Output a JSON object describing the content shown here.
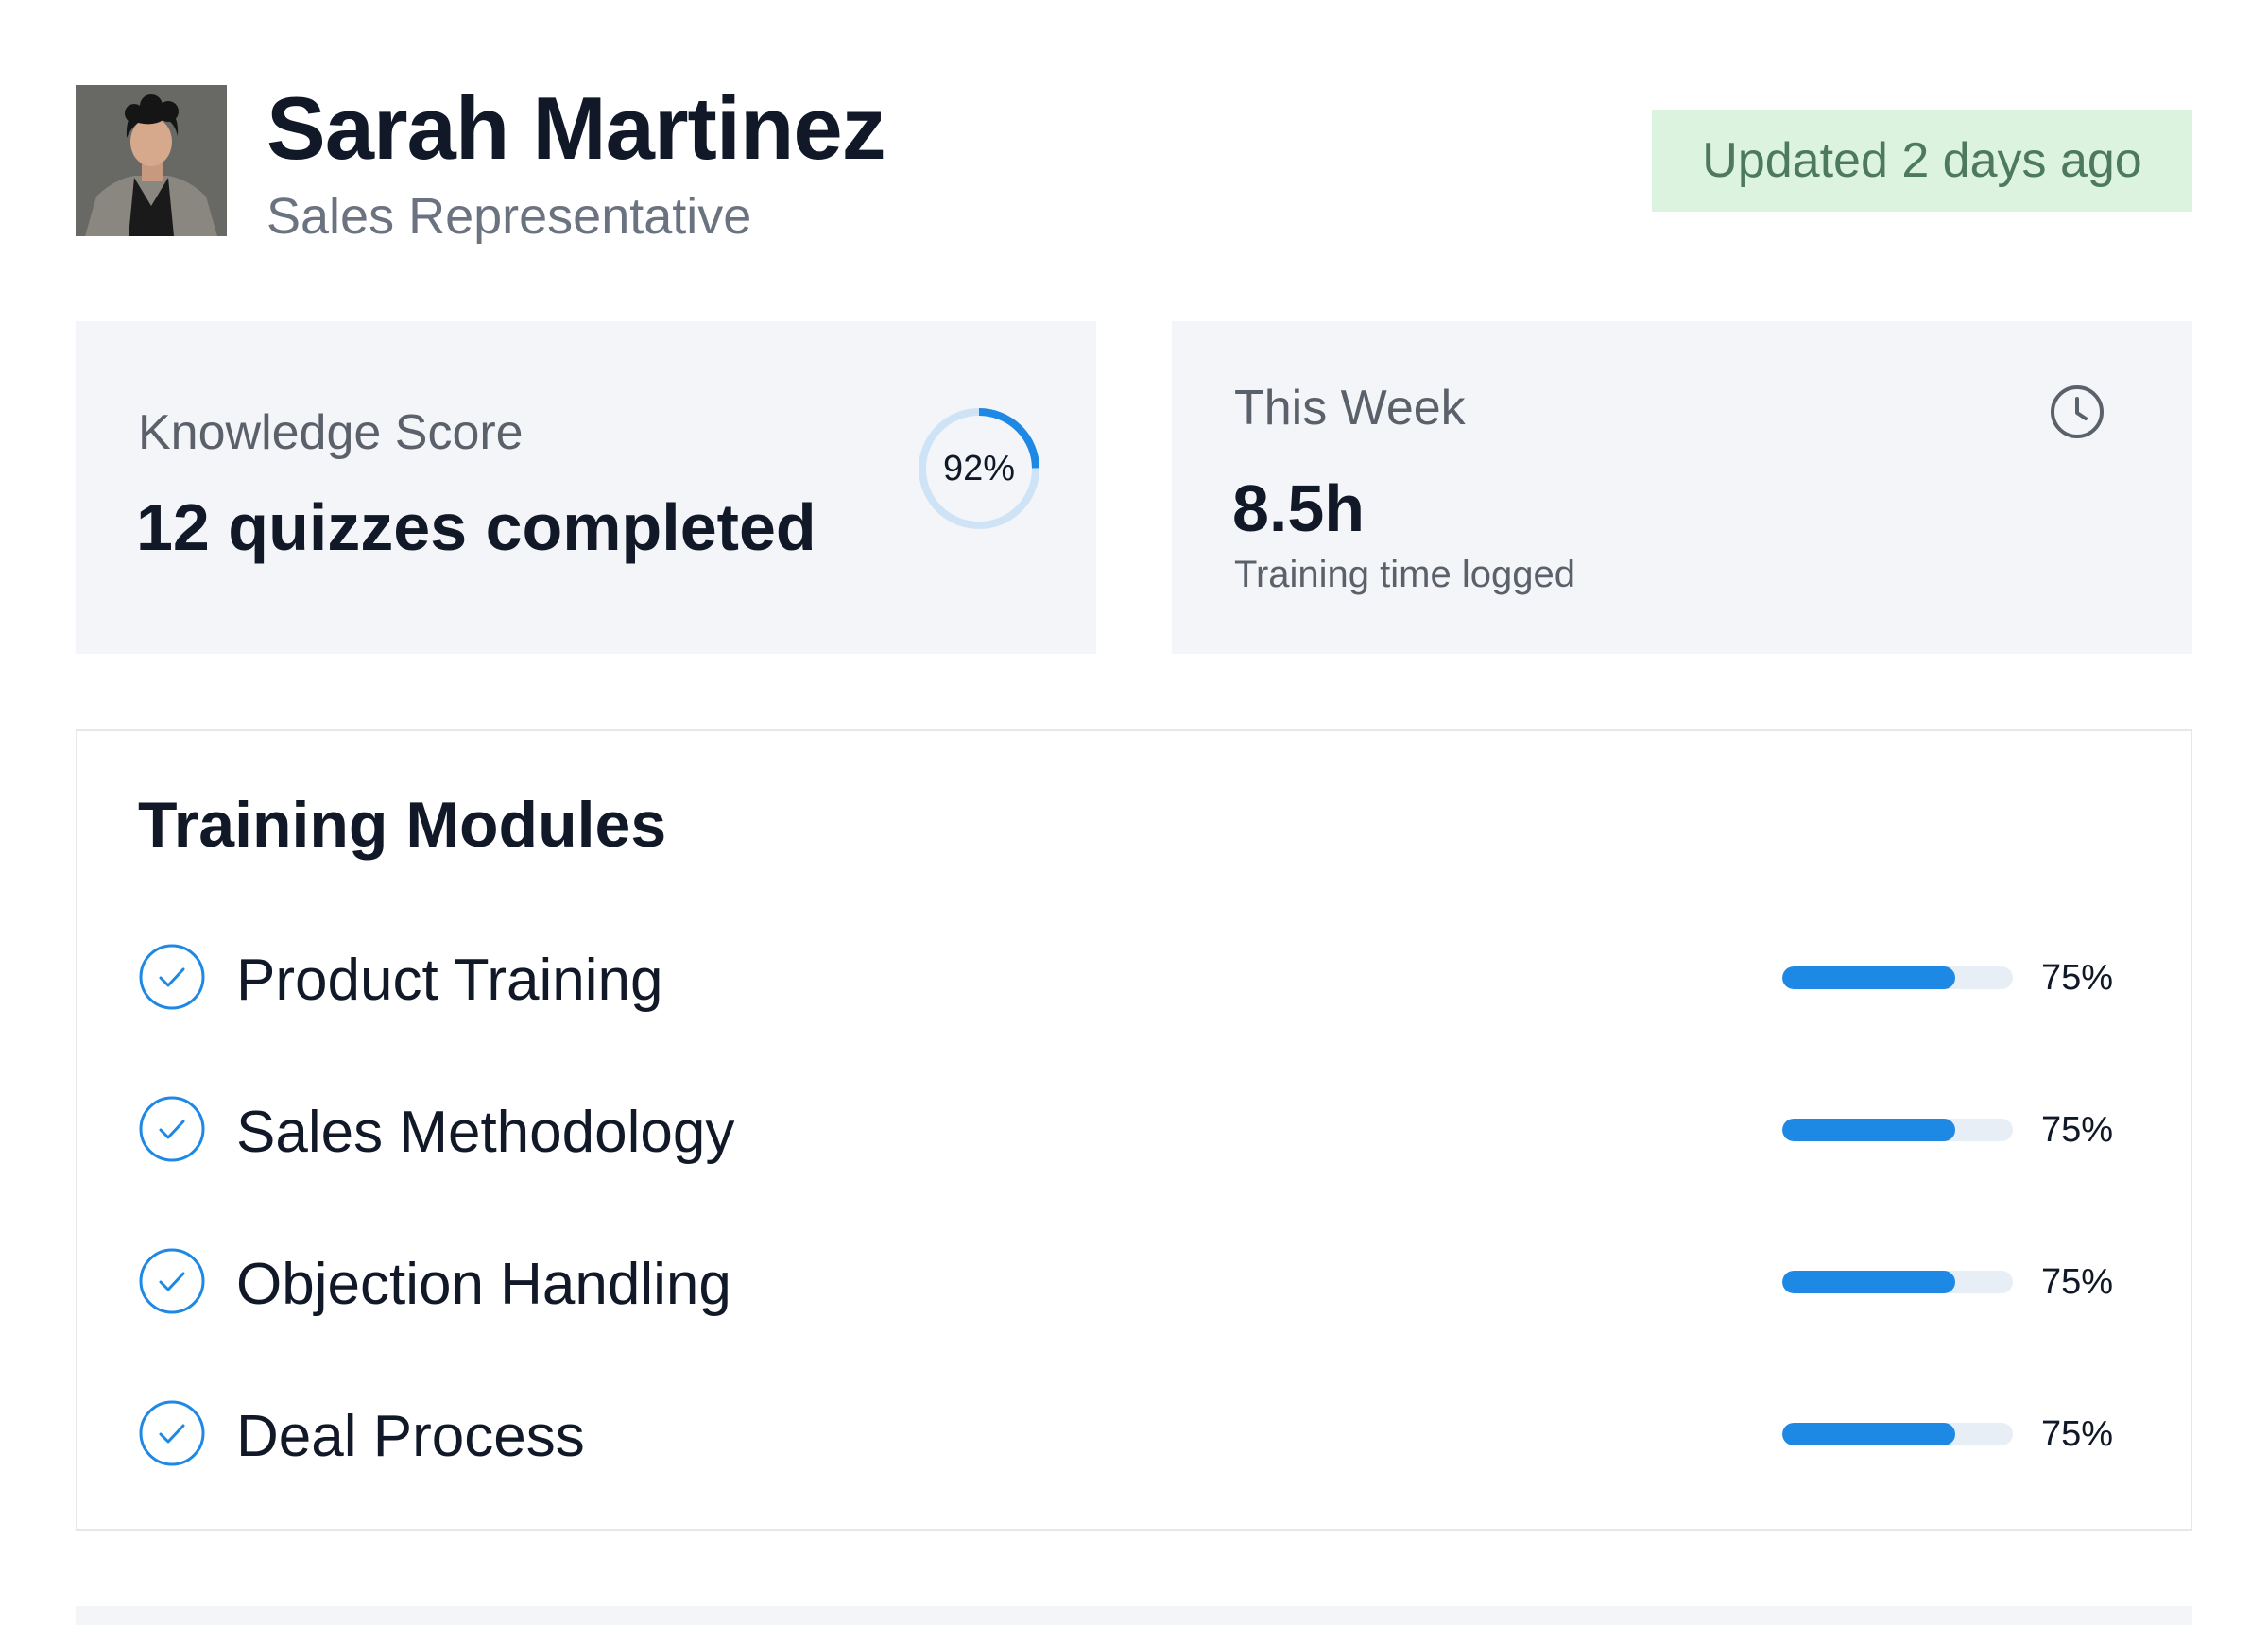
{
  "profile": {
    "name": "Sarah Martinez",
    "role": "Sales Representative",
    "updated": "Updated 2 days ago"
  },
  "knowledge": {
    "label": "Knowledge Score",
    "summary": "12 quizzes completed",
    "score_text": "92%",
    "score_value": 92
  },
  "week": {
    "label": "This Week",
    "value": "8.5h",
    "sub": "Training time logged"
  },
  "modules": {
    "title": "Training Modules",
    "items": [
      {
        "name": "Product Training",
        "progress_text": "75%",
        "progress": 75
      },
      {
        "name": "Sales Methodology",
        "progress_text": "75%",
        "progress": 75
      },
      {
        "name": "Objection Handling",
        "progress_text": "75%",
        "progress": 75
      },
      {
        "name": "Deal Process",
        "progress_text": "75%",
        "progress": 75
      }
    ]
  },
  "colors": {
    "accent": "#1e88e5",
    "accent_light": "#cfe3f7",
    "badge_bg": "#dcf3e0",
    "badge_text": "#4d7a5d",
    "card_bg": "#f4f5f8"
  },
  "icons": {
    "avatar": "user-photo",
    "clock": "clock-icon",
    "check": "check-circle-icon"
  }
}
